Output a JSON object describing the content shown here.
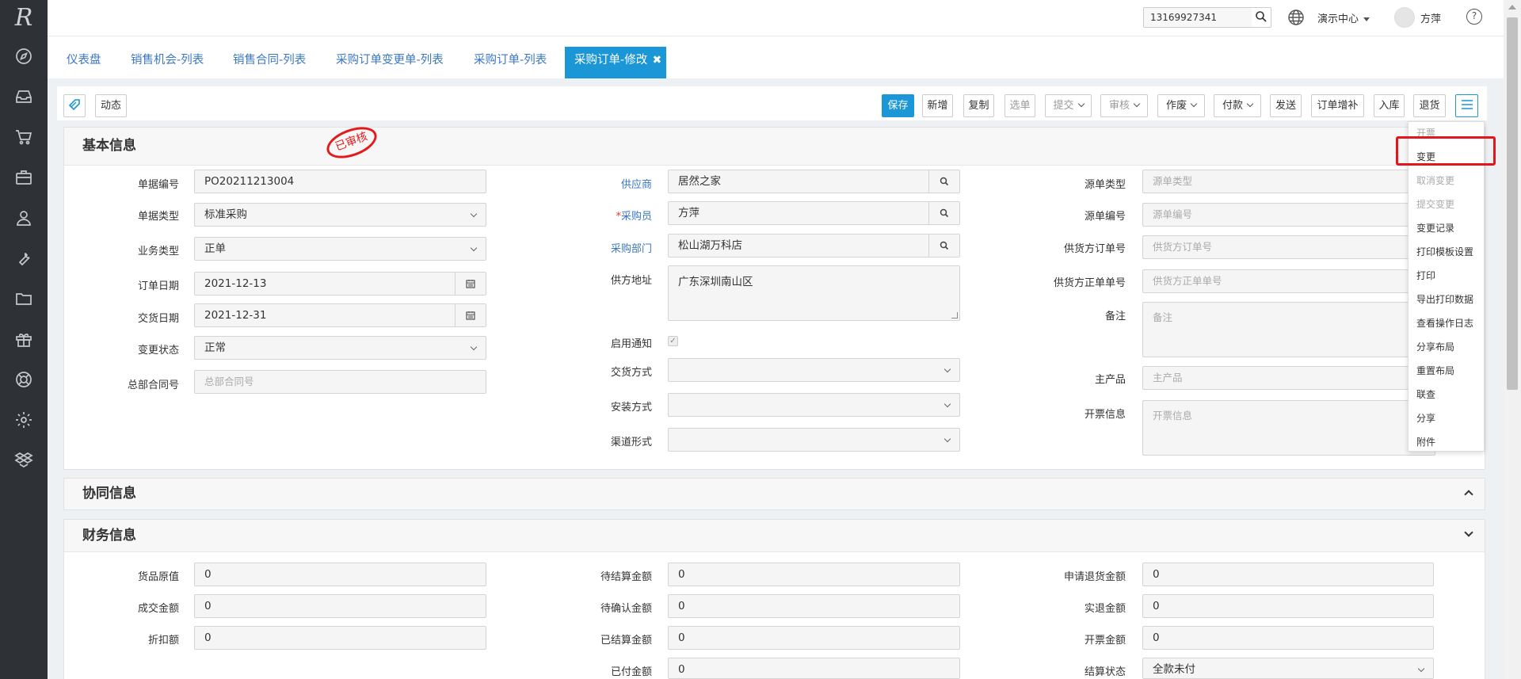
{
  "app": {
    "logo_text": "R"
  },
  "sidebar": {
    "icons": [
      "compass-icon",
      "inbox-icon",
      "cart-icon",
      "briefcase-icon",
      "user-icon",
      "wrench-icon",
      "folder-icon",
      "gift-icon",
      "lifebuoy-icon",
      "gear-icon",
      "dropbox-icon"
    ]
  },
  "header": {
    "search_value": "13169927341",
    "demo_center": "演示中心",
    "username": "方萍",
    "help_label": "?"
  },
  "tabs": [
    {
      "label": "仪表盘"
    },
    {
      "label": "销售机会-列表"
    },
    {
      "label": "销售合同-列表"
    },
    {
      "label": "采购订单变更单-列表"
    },
    {
      "label": "采购订单-列表"
    },
    {
      "label": "采购订单-修改",
      "active": true,
      "close": "✖"
    }
  ],
  "toolbar": {
    "dynamic": "动态",
    "buttons": [
      "保存",
      "新增",
      "复制",
      "选单",
      "提交",
      "审核",
      "作废",
      "付款",
      "发送",
      "订单增补",
      "入库",
      "退货"
    ]
  },
  "stamp": "已审核",
  "basic": {
    "title": "基本信息",
    "doc_no": {
      "label": "单据编号",
      "value": "PO20211213004"
    },
    "doc_type": {
      "label": "单据类型",
      "value": "标准采购"
    },
    "biz_type": {
      "label": "业务类型",
      "value": "正单"
    },
    "order_date": {
      "label": "订单日期",
      "value": "2021-12-13"
    },
    "delivery_date": {
      "label": "交货日期",
      "value": "2021-12-31"
    },
    "change_status": {
      "label": "变更状态",
      "value": "正常"
    },
    "hq_contract": {
      "label": "总部合同号",
      "placeholder": "总部合同号"
    },
    "supplier": {
      "label": "供应商",
      "value": "居然之家"
    },
    "buyer": {
      "label": "采购员",
      "required": "*",
      "value": "方萍"
    },
    "dept": {
      "label": "采购部门",
      "value": "松山湖万科店"
    },
    "supplier_addr": {
      "label": "供方地址",
      "value": "广东深圳南山区"
    },
    "notify": {
      "label": "启用通知",
      "check": "✓"
    },
    "delivery_mode": {
      "label": "交货方式"
    },
    "install_mode": {
      "label": "安装方式"
    },
    "channel": {
      "label": "渠道形式"
    },
    "src_type": {
      "label": "源单类型",
      "placeholder": "源单类型"
    },
    "src_no": {
      "label": "源单编号",
      "placeholder": "源单编号"
    },
    "supplier_order": {
      "label": "供货方订单号",
      "placeholder": "供货方订单号"
    },
    "supplier_formal": {
      "label": "供货方正单单号",
      "placeholder": "供货方正单单号"
    },
    "remark": {
      "label": "备注",
      "placeholder": "备注"
    },
    "main_product": {
      "label": "主产品",
      "placeholder": "主产品"
    },
    "invoice_info": {
      "label": "开票信息",
      "placeholder": "开票信息"
    }
  },
  "collab": {
    "title": "协同信息"
  },
  "finance": {
    "title": "财务信息",
    "goods_value": {
      "label": "货品原值",
      "value": "0"
    },
    "deal_amount": {
      "label": "成交金额",
      "value": "0"
    },
    "discount": {
      "label": "折扣额",
      "value": "0"
    },
    "pending_settle": {
      "label": "待结算金额",
      "value": "0"
    },
    "pending_confirm": {
      "label": "待确认金额",
      "value": "0"
    },
    "settled": {
      "label": "已结算金额",
      "value": "0"
    },
    "paid": {
      "label": "已付金额",
      "value": "0"
    },
    "refund_apply": {
      "label": "申请退货金额",
      "value": "0"
    },
    "refunded": {
      "label": "实退金额",
      "value": "0"
    },
    "invoiced": {
      "label": "开票金额",
      "value": "0"
    },
    "settle_status": {
      "label": "结算状态",
      "value": "全款未付"
    }
  },
  "dropdown": {
    "items": [
      "开票",
      "变更",
      "取消变更",
      "提交变更",
      "变更记录",
      "打印模板设置",
      "打印",
      "导出打印数据",
      "查看操作日志",
      "分享布局",
      "重置布局",
      "联查",
      "分享",
      "附件"
    ]
  }
}
